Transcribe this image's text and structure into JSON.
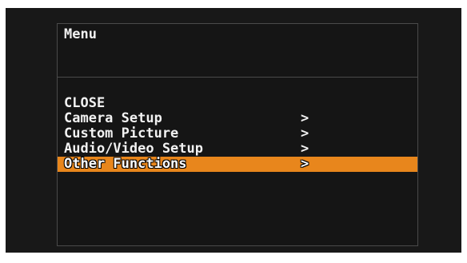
{
  "menu": {
    "title": "Menu",
    "items": [
      {
        "label": "CLOSE",
        "chevron": ""
      },
      {
        "label": "Camera Setup",
        "chevron": ">"
      },
      {
        "label": "Custom Picture",
        "chevron": ">"
      },
      {
        "label": "Audio/Video Setup",
        "chevron": ">"
      },
      {
        "label": "Other Functions",
        "chevron": ">"
      }
    ],
    "selected_index": 4
  },
  "colors": {
    "background": "#181818",
    "highlight": "#e8861c",
    "text": "#f2f2f2",
    "border": "#4a4a4a"
  }
}
